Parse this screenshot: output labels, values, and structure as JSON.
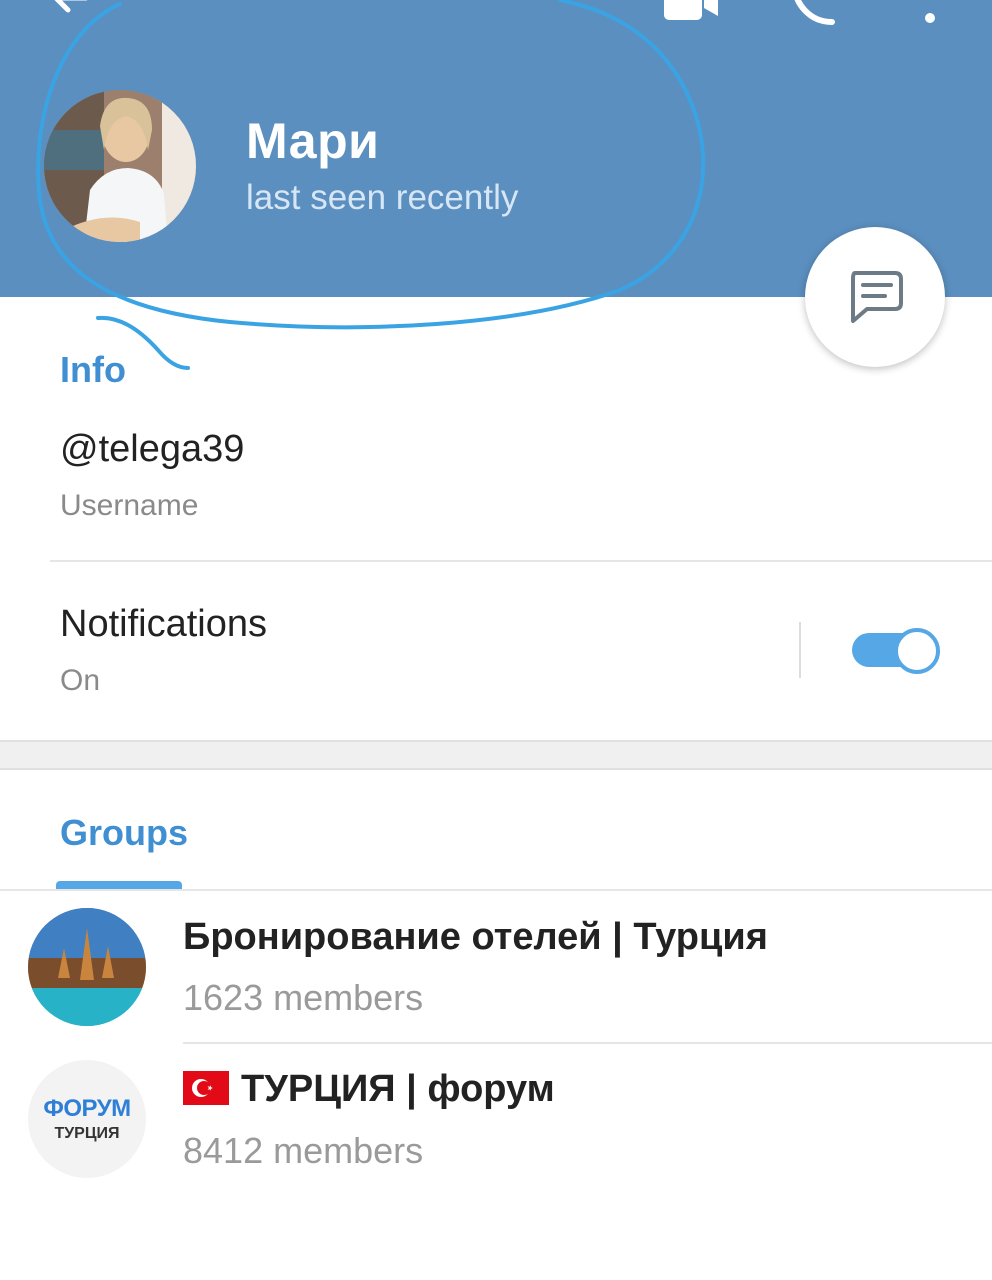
{
  "profile": {
    "name": "Мари",
    "status": "last seen recently"
  },
  "info": {
    "section_title": "Info",
    "username_value": "@telega39",
    "username_label": "Username",
    "notifications_label": "Notifications",
    "notifications_value": "On",
    "notifications_enabled": true
  },
  "groups_tab": {
    "label": "Groups"
  },
  "groups": [
    {
      "name": "Бронирование отелей | Турция",
      "members": "1623 members"
    },
    {
      "name": "ТУРЦИЯ | форум",
      "members": "8412 members",
      "emoji": "turkey-flag"
    }
  ],
  "group_avatar_text": {
    "line1": "ФОРУМ",
    "line2": "ТУРЦИЯ"
  },
  "colors": {
    "header": "#5b8fbf",
    "accent": "#3f8fd2",
    "annotation": "#3aa3e3"
  }
}
